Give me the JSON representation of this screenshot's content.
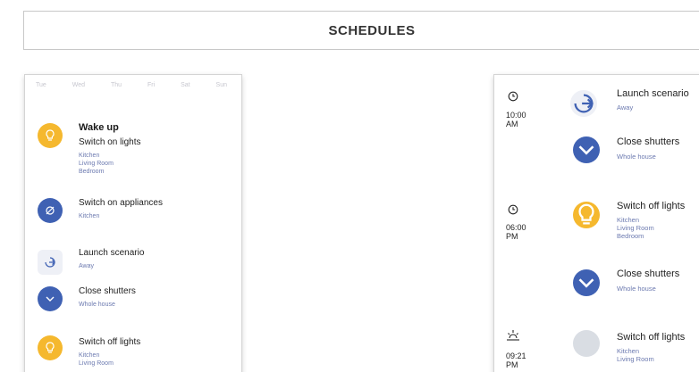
{
  "header": {
    "title": "SCHEDULES"
  },
  "left_panel": {
    "days": [
      "Tue",
      "Wed",
      "Thu",
      "Fri",
      "Sat",
      "Sun"
    ],
    "schedule_title": "Wake up",
    "items": [
      {
        "icon": "bulb-icon",
        "color": "#f5b82e",
        "action": "Switch on lights",
        "subs": [
          "Kitchen",
          "Living Room",
          "Bedroom"
        ]
      },
      {
        "icon": "plug-icon",
        "color": "#3f61b3",
        "action": "Switch on appliances",
        "subs": [
          "Kitchen"
        ]
      },
      {
        "icon": "scenario-icon",
        "color": "#eef0f6",
        "action": "Launch scenario",
        "subs": [
          "Away"
        ]
      },
      {
        "icon": "chevron-down-icon",
        "color": "#3f61b3",
        "action": "Close shutters",
        "subs": [
          "Whole house"
        ]
      },
      {
        "icon": "bulb-icon",
        "color": "#f5b82e",
        "action": "Switch off lights",
        "subs": [
          "Kitchen",
          "Living Room"
        ]
      }
    ]
  },
  "right_panel": {
    "groups": [
      {
        "time_icon": "clock-icon",
        "time": [
          "10:00",
          "AM"
        ]
      },
      {
        "time_icon": "clock-icon",
        "time": [
          "06:00",
          "PM"
        ]
      },
      {
        "time_icon": "sunset-icon",
        "time": [
          "09:21",
          "PM"
        ]
      }
    ],
    "items": [
      {
        "icon": "scenario-icon",
        "title": "Launch scenario",
        "subs": [
          "Away"
        ]
      },
      {
        "icon": "chevron-down-icon",
        "title": "Close shutters",
        "subs": [
          "Whole house"
        ]
      },
      {
        "icon": "bulb-icon",
        "title": "Switch off lights",
        "subs": [
          "Kitchen",
          "Living Room",
          "Bedroom"
        ]
      },
      {
        "icon": "chevron-down-icon",
        "title": "Close shutters",
        "subs": [
          "Whole house"
        ]
      },
      {
        "icon": "bulb-icon",
        "title": "Switch off lights",
        "subs": [
          "Kitchen",
          "Living Room"
        ]
      }
    ]
  }
}
